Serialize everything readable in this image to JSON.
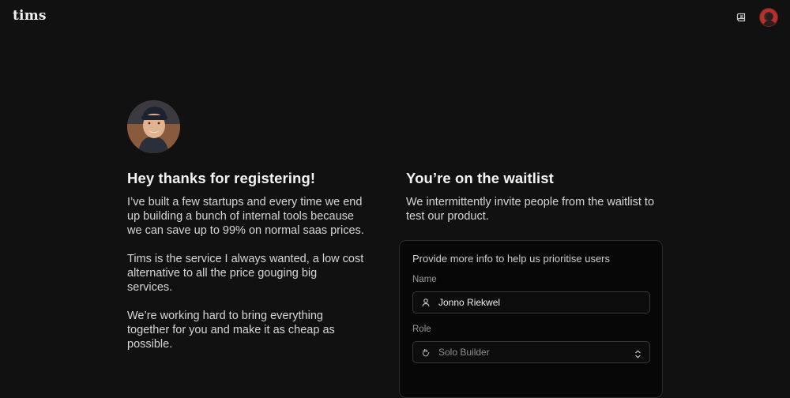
{
  "header": {
    "logo_text": "tims",
    "docs_icon": "book-icon",
    "avatar_icon": "user-avatar"
  },
  "intro": {
    "heading": "Hey thanks for registering!",
    "paragraphs": [
      "I’ve built a few startups and every time we end up building a bunch of internal tools because we can save up to 99% on normal saas prices.",
      "Tims is the service I always wanted, a low cost alternative to all the price gouging big services.",
      "We’re working hard to bring everything together for you and make it as cheap as possible."
    ]
  },
  "waitlist": {
    "heading": "You’re on the waitlist",
    "description": "We intermittently invite people from the waitlist to test our product."
  },
  "form": {
    "title": "Provide more info to help us prioritise users",
    "name_label": "Name",
    "name_value": "Jonno Riekwel",
    "name_icon": "person-icon",
    "role_label": "Role",
    "role_value": "Solo Builder",
    "role_icon": "waving-hand-icon",
    "role_chevron_icon": "chevron-up-down-icon"
  },
  "colors": {
    "background": "#121111",
    "card_background": "#070707",
    "border": "#363636",
    "text": "#ececec"
  }
}
